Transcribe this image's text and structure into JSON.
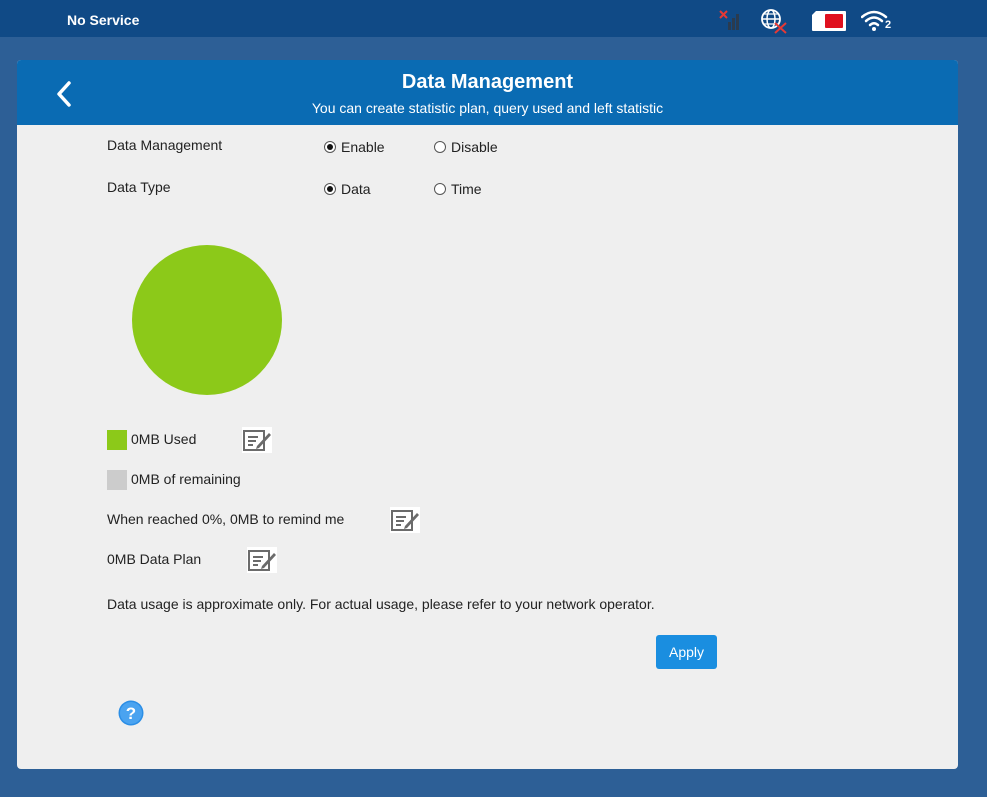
{
  "statusbar": {
    "service_text": "No Service",
    "wifi_clients": "2",
    "icons": [
      "no-signal-icon",
      "globe-disconnected-icon",
      "sim-card-icon",
      "wifi-icon"
    ]
  },
  "header": {
    "title": "Data Management",
    "subtitle": "You can create statistic plan, query used and left statistic"
  },
  "form": {
    "data_management": {
      "label": "Data Management",
      "options": [
        "Enable",
        "Disable"
      ],
      "selected": "Enable"
    },
    "data_type": {
      "label": "Data Type",
      "options": [
        "Data",
        "Time"
      ],
      "selected": "Data"
    }
  },
  "chart_data": {
    "type": "pie",
    "slices": [
      {
        "label": "0MB Used",
        "value": 1,
        "color": "#8cc919"
      },
      {
        "label": "0MB of remaining",
        "value": 0,
        "color": "#cccccc"
      }
    ]
  },
  "legend": {
    "used": "0MB Used",
    "remaining": "0MB of remaining"
  },
  "reminder_text": "When reached 0%, 0MB to remind me",
  "plan_text": "0MB Data Plan",
  "note": "Data usage is approximate only. For actual usage, please refer to your network operator.",
  "apply_label": "Apply",
  "colors": {
    "statusbar": "#104a86",
    "background": "#2d5f96",
    "header": "#0a6bb3",
    "used": "#8cc919",
    "remaining": "#cccccc",
    "apply": "#1a8ee0"
  }
}
